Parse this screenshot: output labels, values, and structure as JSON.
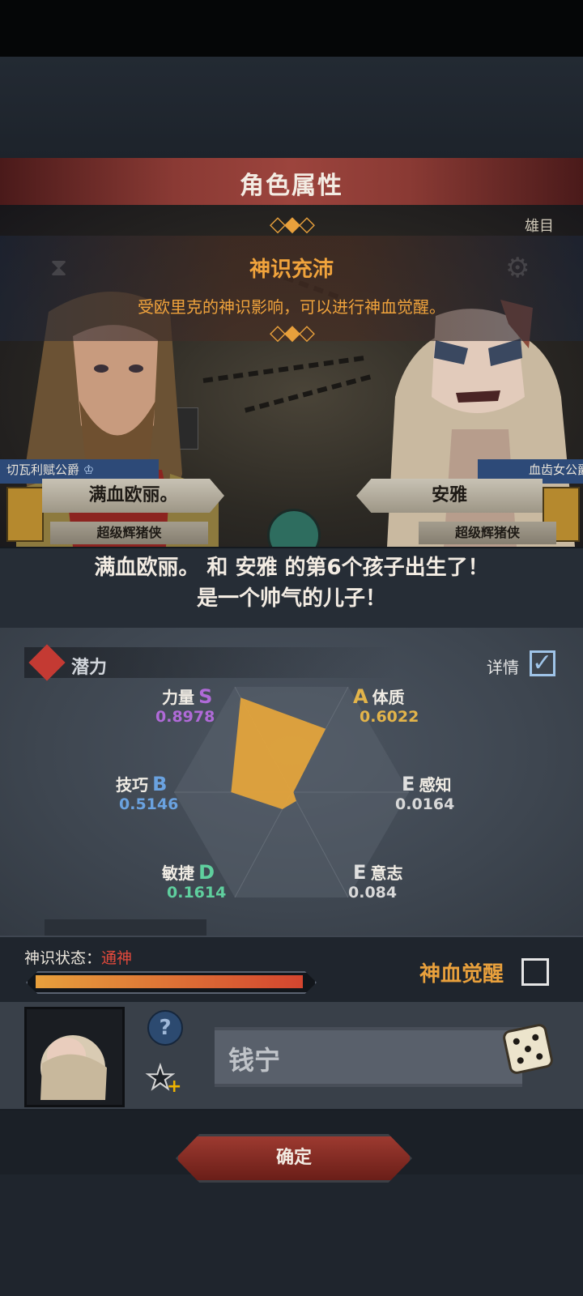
{
  "header": {
    "title": "角色属性"
  },
  "banner": {
    "title": "神识充沛",
    "description": "受欧里克的神识影响，可以进行神血觉醒。"
  },
  "scene": {
    "corner_text": "雄目"
  },
  "father": {
    "rank_tag": "切瓦利赋公爵",
    "name": "满血欧丽。",
    "title": "超级辉猪侠"
  },
  "mother": {
    "rank_tag": "血齿女公爵",
    "name": "安雅",
    "title": "超级辉猪侠"
  },
  "announcement": {
    "line1": "满血欧丽。 和 安雅 的第6个孩子出生了！",
    "line2": "是一个帅气的儿子！"
  },
  "potential": {
    "label": "潜力",
    "detail_label": "详情",
    "detail_checked": true,
    "stats": [
      {
        "name": "力量",
        "grade": "S",
        "value": "0.8978",
        "color": "#b06ad8"
      },
      {
        "name": "体质",
        "grade": "A",
        "value": "0.6022",
        "color": "#e3b44a"
      },
      {
        "name": "感知",
        "grade": "E",
        "value": "0.0164",
        "color": "#d8d8d8"
      },
      {
        "name": "意志",
        "grade": "E",
        "value": "0.084",
        "color": "#d8d8d8"
      },
      {
        "name": "敏捷",
        "grade": "D",
        "value": "0.1614",
        "color": "#5fcf9e"
      },
      {
        "name": "技巧",
        "grade": "B",
        "value": "0.5146",
        "color": "#6aa2e0"
      }
    ],
    "radar_fill": "#e3a43c"
  },
  "divine_state": {
    "label": "神识状态：",
    "value": "通神",
    "progress": 1.0,
    "awaken_label": "神血觉醒",
    "awaken_checked": false
  },
  "child": {
    "name": "钱宁",
    "help_glyph": "?",
    "favorite_plus": "+"
  },
  "confirm": {
    "label": "确定"
  }
}
